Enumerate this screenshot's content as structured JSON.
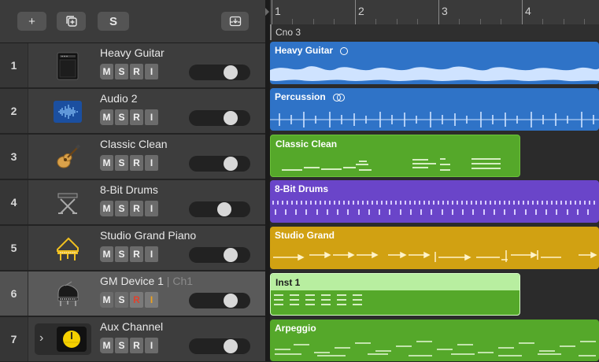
{
  "header": {
    "add_label": "+",
    "duplicate_icon": "duplicate-track-icon",
    "s_label": "S",
    "download_icon": "download-tray-icon"
  },
  "ruler": {
    "bars": [
      "1",
      "2",
      "3",
      "4"
    ]
  },
  "marker": {
    "label": "Cno 3"
  },
  "tracks": [
    {
      "num": "1",
      "name": "Heavy Guitar",
      "icon": "guitar-amp-icon",
      "m": "M",
      "s": "S",
      "r": "R",
      "i": "I",
      "volume": 0.85
    },
    {
      "num": "2",
      "name": "Audio 2",
      "icon": "audio-waveform-icon",
      "m": "M",
      "s": "S",
      "r": "R",
      "i": "I",
      "volume": 0.85
    },
    {
      "num": "3",
      "name": "Classic Clean",
      "icon": "acoustic-guitar-icon",
      "m": "M",
      "s": "S",
      "r": "R",
      "i": "I",
      "volume": 0.85
    },
    {
      "num": "4",
      "name": "8-Bit Drums",
      "icon": "keyboard-stand-icon",
      "m": "M",
      "s": "S",
      "r": "R",
      "i": "I",
      "volume": 0.7
    },
    {
      "num": "5",
      "name": "Studio Grand Piano",
      "icon": "grand-piano-outline-icon",
      "m": "M",
      "s": "S",
      "r": "R",
      "i": "I",
      "volume": 0.85
    },
    {
      "num": "6",
      "name": "GM Device 1",
      "channel": " | Ch1",
      "icon": "grand-piano-icon",
      "m": "M",
      "s": "S",
      "r": "R",
      "i": "I",
      "volume": 0.85
    },
    {
      "num": "7",
      "name": "Aux Channel",
      "icon": "aux-meter-icon",
      "m": "M",
      "s": "S",
      "r": "R",
      "i": "I",
      "volume": 0.85
    }
  ],
  "regions": [
    {
      "name": "Heavy Guitar",
      "color": "#2f73c7"
    },
    {
      "name": "Percussion",
      "color": "#2f73c7"
    },
    {
      "name": "Classic Clean",
      "color": "#55a82a"
    },
    {
      "name": "8-Bit Drums",
      "color": "#6a45c9"
    },
    {
      "name": "Studio Grand",
      "color": "#d1a112"
    },
    {
      "name": "Inst 1",
      "color": "#b8eea0"
    },
    {
      "name": "Arpeggio",
      "color": "#55a82a"
    }
  ]
}
